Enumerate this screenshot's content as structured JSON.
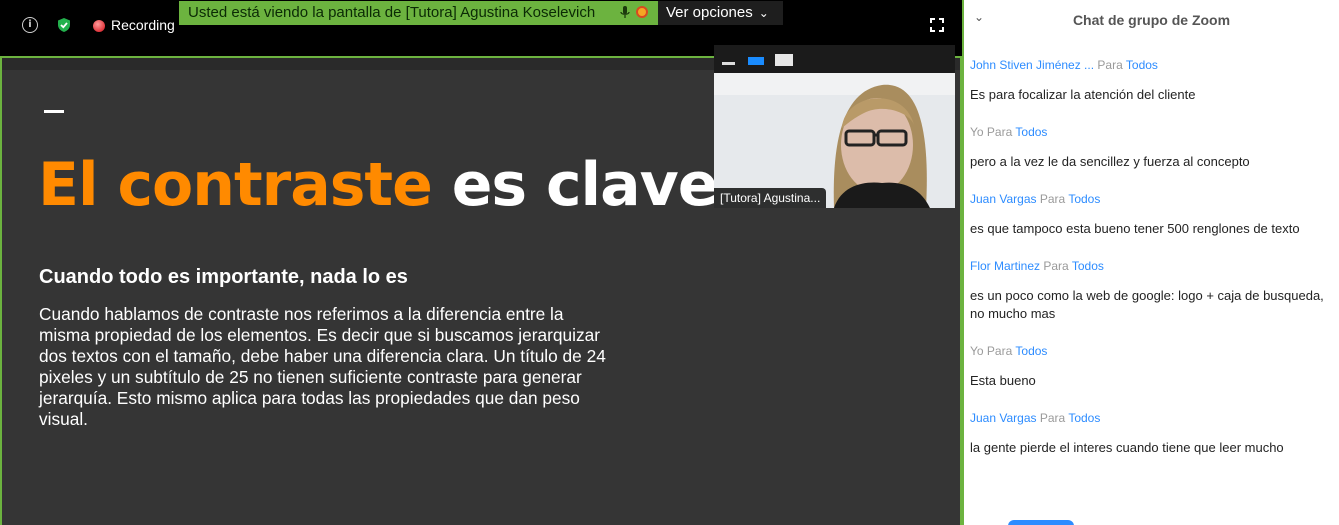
{
  "topbar": {
    "recording_label": "Recording",
    "share_banner_text": "Usted está viendo la pantalla de [Tutora] Agustina Koselevich",
    "view_options_label": "Ver opciones",
    "accent_green": "#6cb33f"
  },
  "slide": {
    "title_orange": "El contraste",
    "title_white": "es clave.",
    "subtitle": "Cuando todo es importante, nada lo es",
    "body": "Cuando hablamos de contraste nos referimos a la diferencia entre la misma propiedad de los elementos. Es decir que si buscamos jerarquizar dos textos con el tamaño, debe haber una diferencia clara. Un título de 24 pixeles y un subtítulo de 25 no tienen suficiente contraste para generar jerarquía. Esto mismo aplica para todas las propiedades que dan peso visual.",
    "accent_orange": "#ff8a00"
  },
  "video": {
    "participant_name": "[Tutora] Agustina..."
  },
  "chat": {
    "title": "Chat de grupo de Zoom",
    "messages": [
      {
        "sender": "John Stiven Jiménez ...",
        "to": "Para",
        "target": "Todos",
        "text": "Es para focalizar la atención del cliente",
        "me": false
      },
      {
        "sender": "Yo",
        "to": "Para",
        "target": "Todos",
        "text": "pero a la vez le da sencillez y fuerza al concepto",
        "me": true
      },
      {
        "sender": "Juan Vargas",
        "to": "Para",
        "target": "Todos",
        "text": "es que tampoco esta bueno tener 500 renglones de texto",
        "me": false
      },
      {
        "sender": "Flor Martinez",
        "to": "Para",
        "target": "Todos",
        "text": "es un poco como la web de google: logo + caja de busqueda, no mucho mas",
        "me": false
      },
      {
        "sender": "Yo",
        "to": "Para",
        "target": "Todos",
        "text": "Esta bueno",
        "me": true
      },
      {
        "sender": "Juan Vargas",
        "to": "Para",
        "target": "Todos",
        "text": "la gente pierde el interes cuando tiene que leer mucho",
        "me": false
      }
    ]
  }
}
